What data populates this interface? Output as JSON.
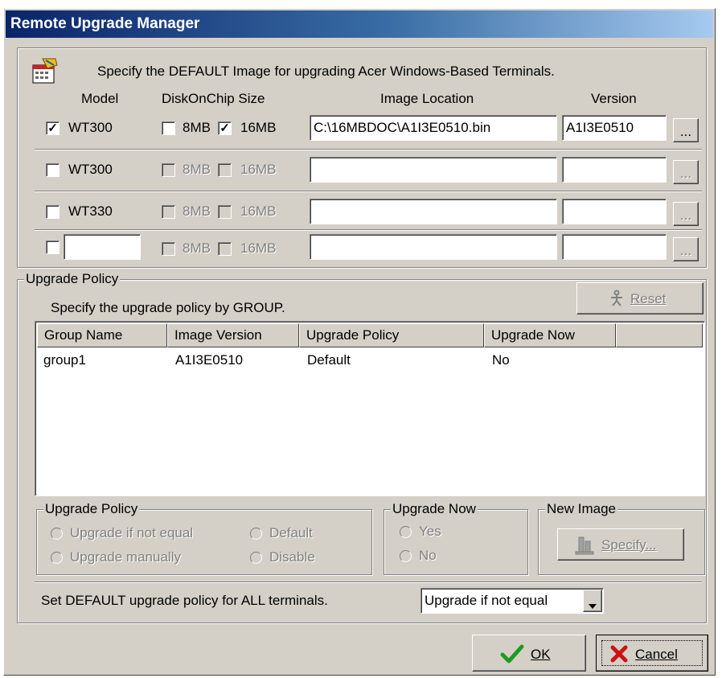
{
  "window": {
    "title": "Remote Upgrade Manager"
  },
  "default_image": {
    "instruction": "Specify the DEFAULT Image for upgrading Acer Windows-Based Terminals.",
    "headers": {
      "model": "Model",
      "disk": "DiskOnChip Size",
      "location": "Image Location",
      "version": "Version"
    },
    "rows": [
      {
        "model_checked": true,
        "model": "WT300",
        "mb8_checked": false,
        "mb16_checked": true,
        "mb8": "8MB",
        "mb16": "16MB",
        "location": "C:\\16MBDOC\\A1I3E0510.bin",
        "version": "A1I3E0510",
        "enabled": true
      },
      {
        "model_checked": false,
        "model": "WT300",
        "mb8_checked": false,
        "mb16_checked": false,
        "mb8": "8MB",
        "mb16": "16MB",
        "location": "",
        "version": "",
        "enabled": false
      },
      {
        "model_checked": false,
        "model": "WT330",
        "mb8_checked": false,
        "mb16_checked": false,
        "mb8": "8MB",
        "mb16": "16MB",
        "location": "",
        "version": "",
        "enabled": false
      },
      {
        "model_checked": false,
        "model": "",
        "mb8_checked": false,
        "mb16_checked": false,
        "mb8": "8MB",
        "mb16": "16MB",
        "location": "",
        "version": "",
        "enabled": false
      }
    ],
    "browse_label": "..."
  },
  "upgrade_policy": {
    "legend": "Upgrade Policy",
    "instruction": "Specify the upgrade policy by GROUP.",
    "reset_label": "Reset",
    "columns": [
      "Group Name",
      "Image Version",
      "Upgrade Policy",
      "Upgrade Now"
    ],
    "rows": [
      [
        "group1",
        "A1I3E0510",
        "Default",
        "No"
      ]
    ],
    "policy_group": {
      "legend": "Upgrade Policy",
      "options": [
        "Upgrade if not equal",
        "Default",
        "Upgrade manually",
        "Disable"
      ]
    },
    "now_group": {
      "legend": "Upgrade Now",
      "options": [
        "Yes",
        "No"
      ]
    },
    "new_image_group": {
      "legend": "New Image",
      "specify_label": "Specify..."
    },
    "default_label": "Set DEFAULT upgrade policy for ALL terminals.",
    "default_value": "Upgrade if not equal"
  },
  "buttons": {
    "ok": "OK",
    "cancel": "Cancel"
  },
  "icons": {
    "app": "app-image-icon",
    "reset": "reset-person-icon",
    "specify": "specify-image-icon",
    "ok": "check-icon",
    "cancel": "x-icon"
  }
}
